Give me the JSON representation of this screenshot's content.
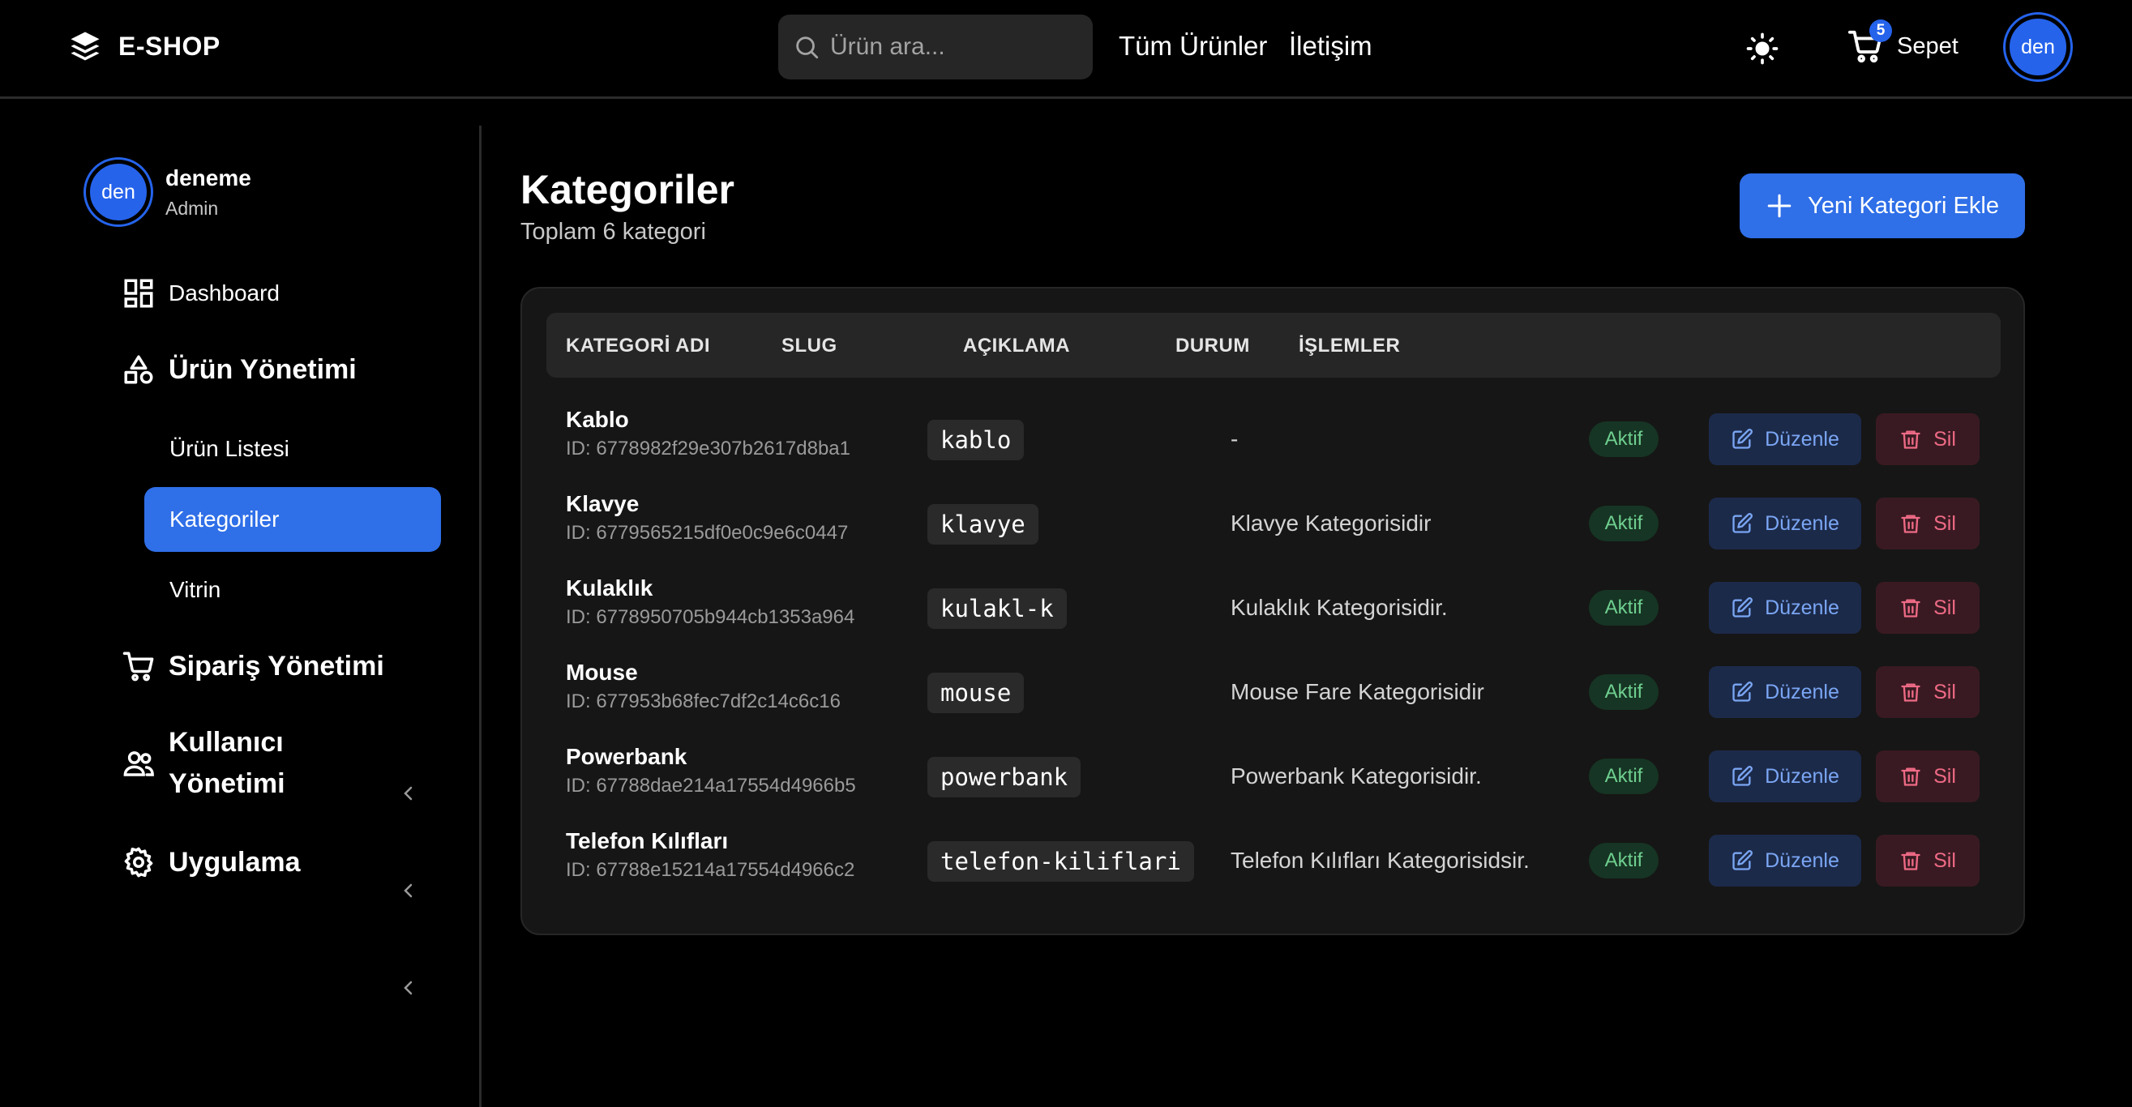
{
  "navbar": {
    "brand": "E-SHOP",
    "search_placeholder": "Ürün ara...",
    "links": [
      "Tüm Ürünler",
      "İletişim"
    ],
    "cart_label": "Sepet",
    "cart_count": "5",
    "avatar": "den"
  },
  "sidebar": {
    "user": {
      "avatar": "den",
      "name": "deneme",
      "role": "Admin"
    },
    "dashboard": "Dashboard",
    "product_mgmt": "Ürün Yönetimi",
    "sub_items": [
      "Ürün Listesi",
      "Kategoriler",
      "Vitrin"
    ],
    "order_mgmt": "Sipariş Yönetimi",
    "user_mgmt_line1": "Kullanıcı",
    "user_mgmt_line2": "Yönetimi",
    "app": "Uygulama"
  },
  "main": {
    "title": "Kategoriler",
    "subtitle": "Toplam 6 kategori",
    "add_button": "Yeni Kategori Ekle",
    "columns": [
      "KATEGORİ ADI",
      "SLUG",
      "AÇIKLAMA",
      "DURUM",
      "İŞLEMLER"
    ],
    "edit_label": "Düzenle",
    "delete_label": "Sil",
    "rows": [
      {
        "name": "Kablo",
        "id": "ID: 6778982f29e307b2617d8ba1",
        "slug": "kablo",
        "desc": "-",
        "status": "Aktif"
      },
      {
        "name": "Klavye",
        "id": "ID: 6779565215df0e0c9e6c0447",
        "slug": "klavye",
        "desc": "Klavye Kategorisidir",
        "status": "Aktif"
      },
      {
        "name": "Kulaklık",
        "id": "ID: 6778950705b944cb1353a964",
        "slug": "kulakl-k",
        "desc": "Kulaklık Kategorisidir.",
        "status": "Aktif"
      },
      {
        "name": "Mouse",
        "id": "ID: 677953b68fec7df2c14c6c16",
        "slug": "mouse",
        "desc": "Mouse Fare Kategorisidir",
        "status": "Aktif"
      },
      {
        "name": "Powerbank",
        "id": "ID: 67788dae214a17554d4966b5",
        "slug": "powerbank",
        "desc": "Powerbank Kategorisidir.",
        "status": "Aktif"
      },
      {
        "name": "Telefon Kılıfları",
        "id": "ID: 67788e15214a17554d4966c2",
        "slug": "telefon-kiliflari",
        "desc": "Telefon Kılıfları Kategorisidsir.",
        "status": "Aktif"
      }
    ]
  },
  "colors": {
    "accent": "#2f6fe8",
    "active_status": "#6fcf8f",
    "edit": "#7aa6f3",
    "delete": "#ee6a85"
  }
}
